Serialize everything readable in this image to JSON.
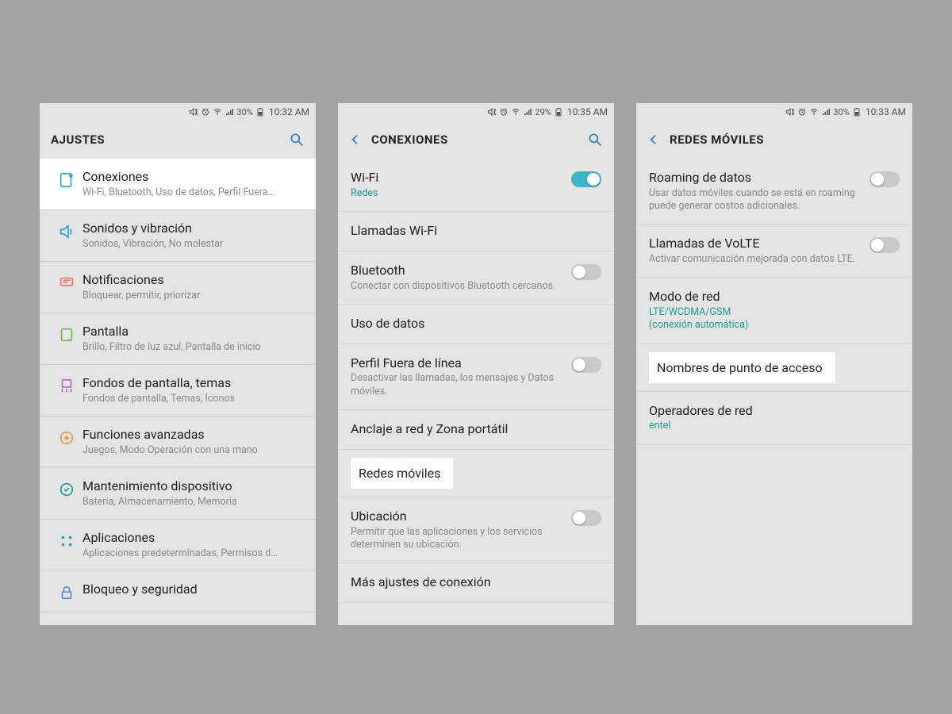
{
  "screens": [
    {
      "status": {
        "battery": "30%",
        "time": "10:32 AM"
      },
      "header": {
        "title": "AJUSTES",
        "back": false,
        "search": true
      },
      "items": [
        {
          "icon": "connections",
          "color": "#2aa2c6",
          "title": "Conexiones",
          "sub": "Wi-Fi, Bluetooth, Uso de datos, Perfil Fuera…",
          "highlight": true
        },
        {
          "icon": "sound",
          "color": "#2aa2c6",
          "title": "Sonidos y vibración",
          "sub": "Sonidos, Vibración, No molestar"
        },
        {
          "icon": "notif",
          "color": "#e57b6d",
          "title": "Notificaciones",
          "sub": "Bloquear, permitir, priorizar"
        },
        {
          "icon": "display",
          "color": "#6cb85b",
          "title": "Pantalla",
          "sub": "Brillo, Filtro de luz azul, Pantalla de inicio"
        },
        {
          "icon": "wallpaper",
          "color": "#b06dbb",
          "title": "Fondos de pantalla, temas",
          "sub": "Fondos de pantalla, Temas, Íconos"
        },
        {
          "icon": "advanced",
          "color": "#e2a14b",
          "title": "Funciones avanzadas",
          "sub": "Juegos, Modo Operación con una mano"
        },
        {
          "icon": "maint",
          "color": "#1f9b92",
          "title": "Mantenimiento dispositivo",
          "sub": "Batería, Almacenamiento, Memoria"
        },
        {
          "icon": "apps",
          "color": "#2aa2c6",
          "title": "Aplicaciones",
          "sub": "Aplicaciones predeterminadas, Permisos d…"
        },
        {
          "icon": "lock",
          "color": "#5b8bd3",
          "title": "Bloqueo y seguridad",
          "sub": ""
        }
      ]
    },
    {
      "status": {
        "battery": "29%",
        "time": "10:35 AM"
      },
      "header": {
        "title": "CONEXIONES",
        "back": true,
        "search": true
      },
      "items": [
        {
          "title": "Wi-Fi",
          "sub": "Redes",
          "sub_color": "teal",
          "toggle": "on"
        },
        {
          "title": "Llamadas Wi-Fi"
        },
        {
          "title": "Bluetooth",
          "sub": "Conectar con dispositivos Bluetooth cercanos.",
          "toggle": "off"
        },
        {
          "title": "Uso de datos"
        },
        {
          "title": "Perfil Fuera de línea",
          "sub": "Desactivar las llamadas, los mensajes y Datos móviles.",
          "toggle": "off"
        },
        {
          "title": "Anclaje a red y Zona portátil"
        },
        {
          "title": "Redes móviles",
          "pill": true
        },
        {
          "title": "Ubicación",
          "sub": "Permitir que las aplicaciones y los servicios determinen su ubicación.",
          "toggle": "off"
        },
        {
          "title": "Más ajustes de conexión"
        }
      ]
    },
    {
      "status": {
        "battery": "30%",
        "time": "10:33 AM"
      },
      "header": {
        "title": "REDES MÓVILES",
        "back": true,
        "search": false
      },
      "items": [
        {
          "title": "Roaming de datos",
          "sub": "Usar datos móviles cuando se está en roaming puede generar costos adicionales.",
          "toggle": "off"
        },
        {
          "title": "Llamadas de VoLTE",
          "sub": "Activar comunicación mejorada con datos LTE.",
          "toggle": "off"
        },
        {
          "title": "Modo de red",
          "sub": "LTE/WCDMA/GSM\n(conexión automática)",
          "sub_color": "teal"
        },
        {
          "title": "Nombres de punto de acceso",
          "pill": true
        },
        {
          "title": "Operadores de red",
          "sub": "entel",
          "sub_color": "teal"
        }
      ]
    }
  ]
}
